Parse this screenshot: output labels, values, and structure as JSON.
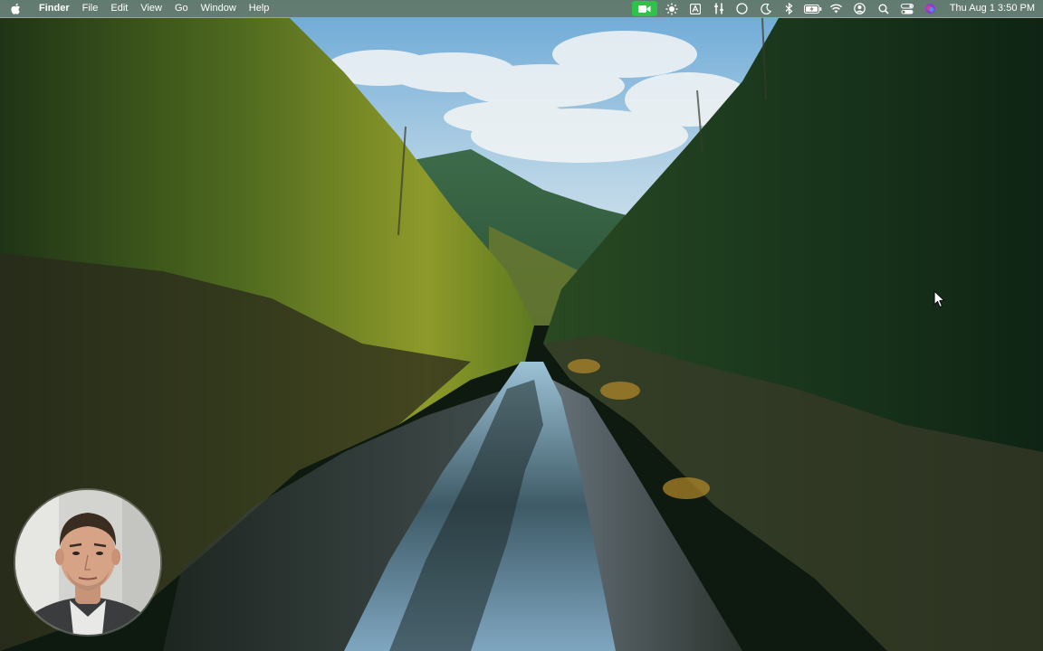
{
  "menubar": {
    "apple_icon": "apple-logo-icon",
    "app_name": "Finder",
    "menus": [
      "File",
      "Edit",
      "View",
      "Go",
      "Window",
      "Help"
    ],
    "status_icons": [
      "camera-recording-icon",
      "brightness-icon",
      "text-input-icon",
      "tools-icon",
      "circle-icon",
      "moon-icon",
      "bluetooth-icon",
      "battery-charging-icon",
      "wifi-icon",
      "user-account-icon",
      "search-icon",
      "control-center-icon",
      "siri-icon"
    ],
    "clock": "Thu Aug 1  3:50 PM",
    "recording_color": "#2dc34a"
  },
  "desktop": {
    "wallpaper": "river-canyon-forest"
  },
  "webcam": {
    "icon": "presenter-webcam-overlay"
  },
  "cursor": {
    "icon": "arrow-cursor-icon"
  }
}
